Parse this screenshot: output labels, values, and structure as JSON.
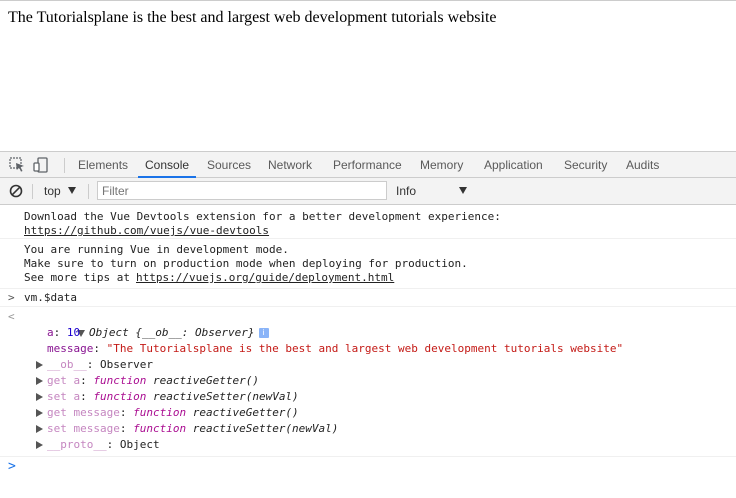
{
  "page": {
    "text": "The Tutorialsplane is the best and largest web development tutorials website"
  },
  "devtools": {
    "tabs": [
      "Elements",
      "Console",
      "Sources",
      "Network",
      "Performance",
      "Memory",
      "Application",
      "Security",
      "Audits"
    ],
    "active_tab": "Console",
    "icons": {
      "inspect": "inspect-element-icon",
      "device": "device-toolbar-icon",
      "clear": "clear-console-icon"
    },
    "filterbar": {
      "context": "top",
      "filter_placeholder": "Filter",
      "level": "Info"
    }
  },
  "console": {
    "msg1": {
      "line1": "Download the Vue Devtools extension for a better development experience:",
      "link": "https://github.com/vuejs/vue-devtools"
    },
    "msg2": {
      "line1": "You are running Vue in development mode.",
      "line2": "Make sure to turn on production mode when deploying for production.",
      "prefix": "See more tips at ",
      "link": "https://vuejs.org/guide/deployment.html"
    },
    "input_cmd": "vm.$data",
    "object": {
      "header": "Object {__ob__: Observer}",
      "info_badge": "i",
      "a_key": "a",
      "a_val": "10",
      "message_key": "message",
      "message_val": "\"The Tutorialsplane is the best and largest web development tutorials website\"",
      "ob_key": "__ob__",
      "ob_val": "Observer",
      "get_a_key": "get a",
      "get_a_kw": "function",
      "get_a_fn": "reactiveGetter()",
      "set_a_key": "set a",
      "set_a_kw": "function",
      "set_a_fn": "reactiveSetter(newVal)",
      "get_msg_key": "get message",
      "get_msg_kw": "function",
      "get_msg_fn": "reactiveGetter()",
      "set_msg_key": "set message",
      "set_msg_kw": "function",
      "set_msg_fn": "reactiveSetter(newVal)",
      "proto_key": "__proto__",
      "proto_val": "Object"
    }
  }
}
